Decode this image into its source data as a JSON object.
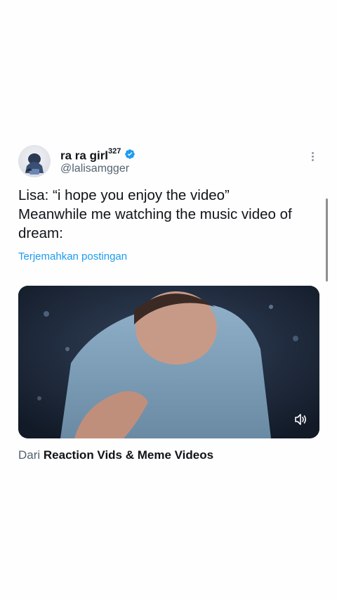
{
  "author": {
    "display_name": "ra ra girl",
    "display_name_sup": "327",
    "handle": "@lalisamgger",
    "verified": true,
    "avatar_icon": "user-avatar",
    "accent": "#1d9bf0"
  },
  "tweet": {
    "text": "Lisa: “i hope you enjoy the video”\nMeanwhile me watching the music video of dream:",
    "translate_label": "Terjemahkan postingan"
  },
  "media": {
    "type": "video",
    "mute_icon": "volume-muted-icon"
  },
  "source": {
    "prefix": "Dari",
    "name": "Reaction Vids & Meme Videos"
  },
  "colors": {
    "text": "#0f1419",
    "muted": "#536471",
    "link": "#1d9bf0"
  }
}
